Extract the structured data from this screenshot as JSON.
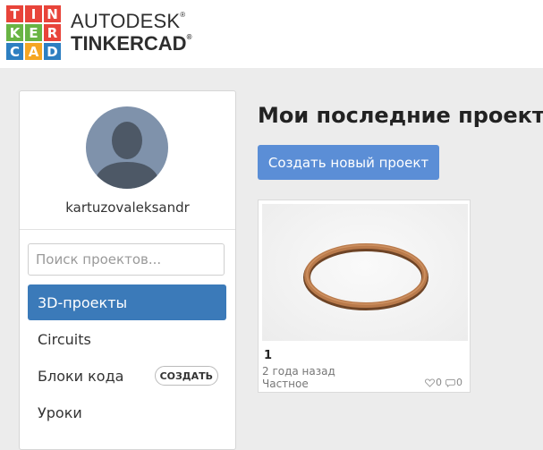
{
  "header": {
    "logo_letters": [
      "T",
      "I",
      "N",
      "K",
      "E",
      "R",
      "C",
      "A",
      "D"
    ],
    "logo_colors": [
      "#e8443a",
      "#e8443a",
      "#e8443a",
      "#69b444",
      "#69b444",
      "#e8443a",
      "#2d7fc1",
      "#f5a623",
      "#2d7fc1"
    ],
    "brand_top": "AUTODESK",
    "brand_bottom": "TINKERCAD",
    "reg_mark": "®"
  },
  "sidebar": {
    "username": "kartuzovaleksandr",
    "search_placeholder": "Поиск проектов...",
    "items": [
      {
        "label": "3D-проекты",
        "active": true
      },
      {
        "label": "Circuits"
      },
      {
        "label": "Блоки кода",
        "badge": "СОЗДАТЬ"
      },
      {
        "label": "Уроки"
      }
    ]
  },
  "main": {
    "title": "Мои последние проекты",
    "create_button": "Создать новый проект",
    "projects": [
      {
        "name": "1",
        "date": "2 года назад",
        "privacy": "Частное",
        "likes": "0",
        "comments": "0"
      }
    ]
  },
  "colors": {
    "accent_active": "#3b7ab9",
    "create_button": "#5b8ed6",
    "ring": "#b97a4b"
  }
}
